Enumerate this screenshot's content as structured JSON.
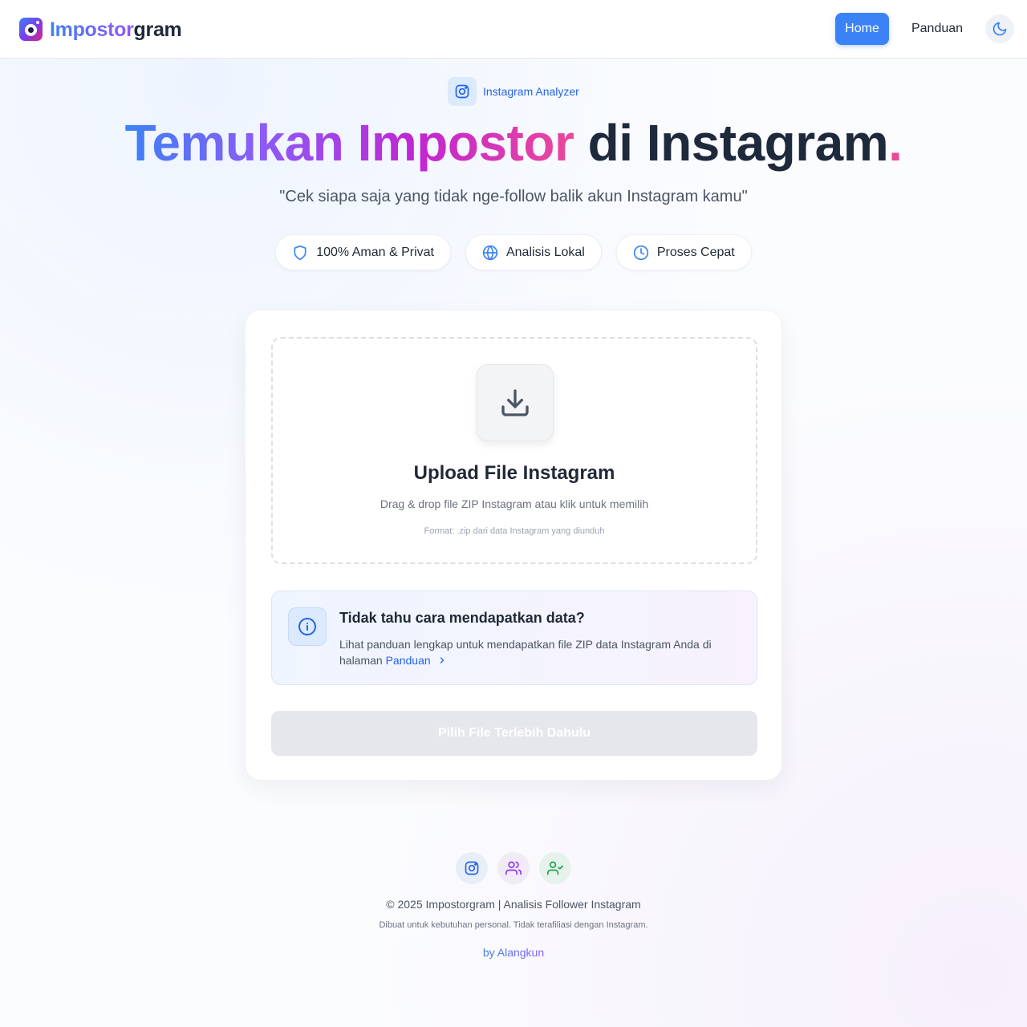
{
  "header": {
    "brand_part1": "Impostor",
    "brand_part2": "gram",
    "nav": {
      "home": "Home",
      "guide": "Panduan"
    },
    "theme_toggle_icon": "moon-icon"
  },
  "hero": {
    "badge": "Instagram Analyzer",
    "title_gradient": "Temukan Impostor",
    "title_plain": " di Instagram",
    "title_dot": ".",
    "subtitle": "\"Cek siapa saja yang tidak nge-follow balik akun Instagram kamu\"",
    "features": [
      {
        "label": "100% Aman & Privat",
        "icon": "shield-icon"
      },
      {
        "label": "Analisis Lokal",
        "icon": "globe-icon"
      },
      {
        "label": "Proses Cepat",
        "icon": "clock-icon"
      }
    ]
  },
  "upload": {
    "icon": "download-icon",
    "title": "Upload File Instagram",
    "description": "Drag & drop file ZIP Instagram atau klik untuk memilih",
    "format_note": "Format: .zip dari data Instagram yang diunduh"
  },
  "info": {
    "icon": "info-icon",
    "title": "Tidak tahu cara mendapatkan data?",
    "text": "Lihat panduan lengkap untuk mendapatkan file ZIP data Instagram Anda di halaman",
    "link_label": "Panduan"
  },
  "submit": {
    "label": "Pilih File Terlebih Dahulu"
  },
  "footer": {
    "icons": [
      "instagram-icon",
      "users-icon",
      "user-check-icon"
    ],
    "copyright": "© 2025 Impostorgram | Analisis Follower Instagram",
    "disclaimer": "Dibuat untuk kebutuhan personal. Tidak terafiliasi dengan Instagram.",
    "author": "by Alangkun"
  },
  "colors": {
    "primary": "#3b82f6",
    "accent_purple": "#8b5cf6",
    "accent_pink": "#ec4899",
    "text_dark": "#1e293b",
    "button_disabled": "#e5e7eb"
  }
}
